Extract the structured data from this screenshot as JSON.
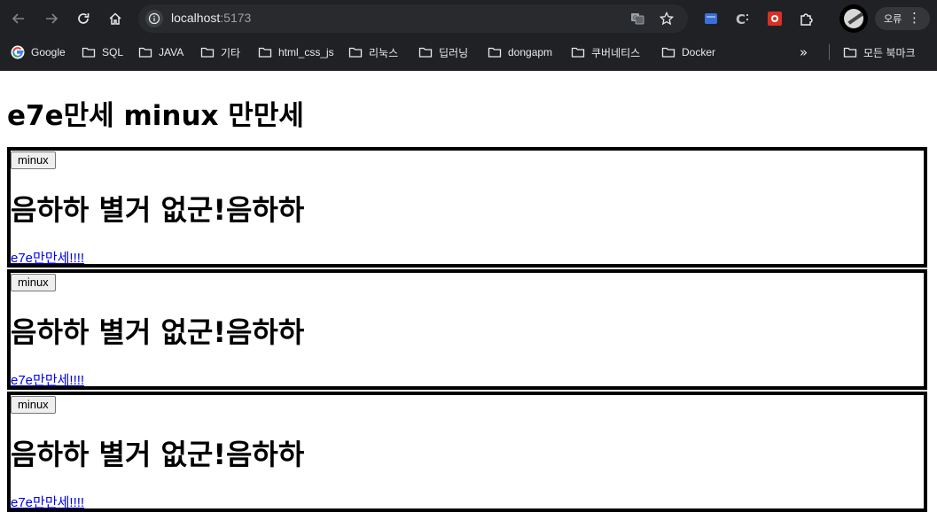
{
  "browser": {
    "url_host": "localhost",
    "url_port": ":5173",
    "profile_error_label": "오류",
    "bookmarks": [
      {
        "label": "Google",
        "icon": "google-icon"
      },
      {
        "label": "SQL",
        "icon": "folder-icon"
      },
      {
        "label": "JAVA",
        "icon": "folder-icon"
      },
      {
        "label": "기타",
        "icon": "folder-icon"
      },
      {
        "label": "html_css_js",
        "icon": "folder-icon"
      },
      {
        "label": "리눅스",
        "icon": "folder-icon"
      },
      {
        "label": "딥러닝",
        "icon": "folder-icon"
      },
      {
        "label": "dongapm",
        "icon": "folder-icon"
      },
      {
        "label": "쿠버네티스",
        "icon": "folder-icon"
      },
      {
        "label": "Docker",
        "icon": "folder-icon"
      }
    ],
    "all_bookmarks_label": "모든 북마크",
    "colors": {
      "chrome_bg": "#202124",
      "omnibox_bg": "#282a2d",
      "link": "#0000ee"
    }
  },
  "page": {
    "title": "e7e만세 minux 만만세",
    "cards": [
      {
        "button_label": "minux",
        "heading": "음하하 별거 없군!음하하",
        "link_text": "e7e만만세!!!!"
      },
      {
        "button_label": "minux",
        "heading": "음하하 별거 없군!음하하",
        "link_text": "e7e만만세!!!!"
      },
      {
        "button_label": "minux",
        "heading": "음하하 별거 없군!음하하",
        "link_text": "e7e만만세!!!!"
      }
    ]
  }
}
